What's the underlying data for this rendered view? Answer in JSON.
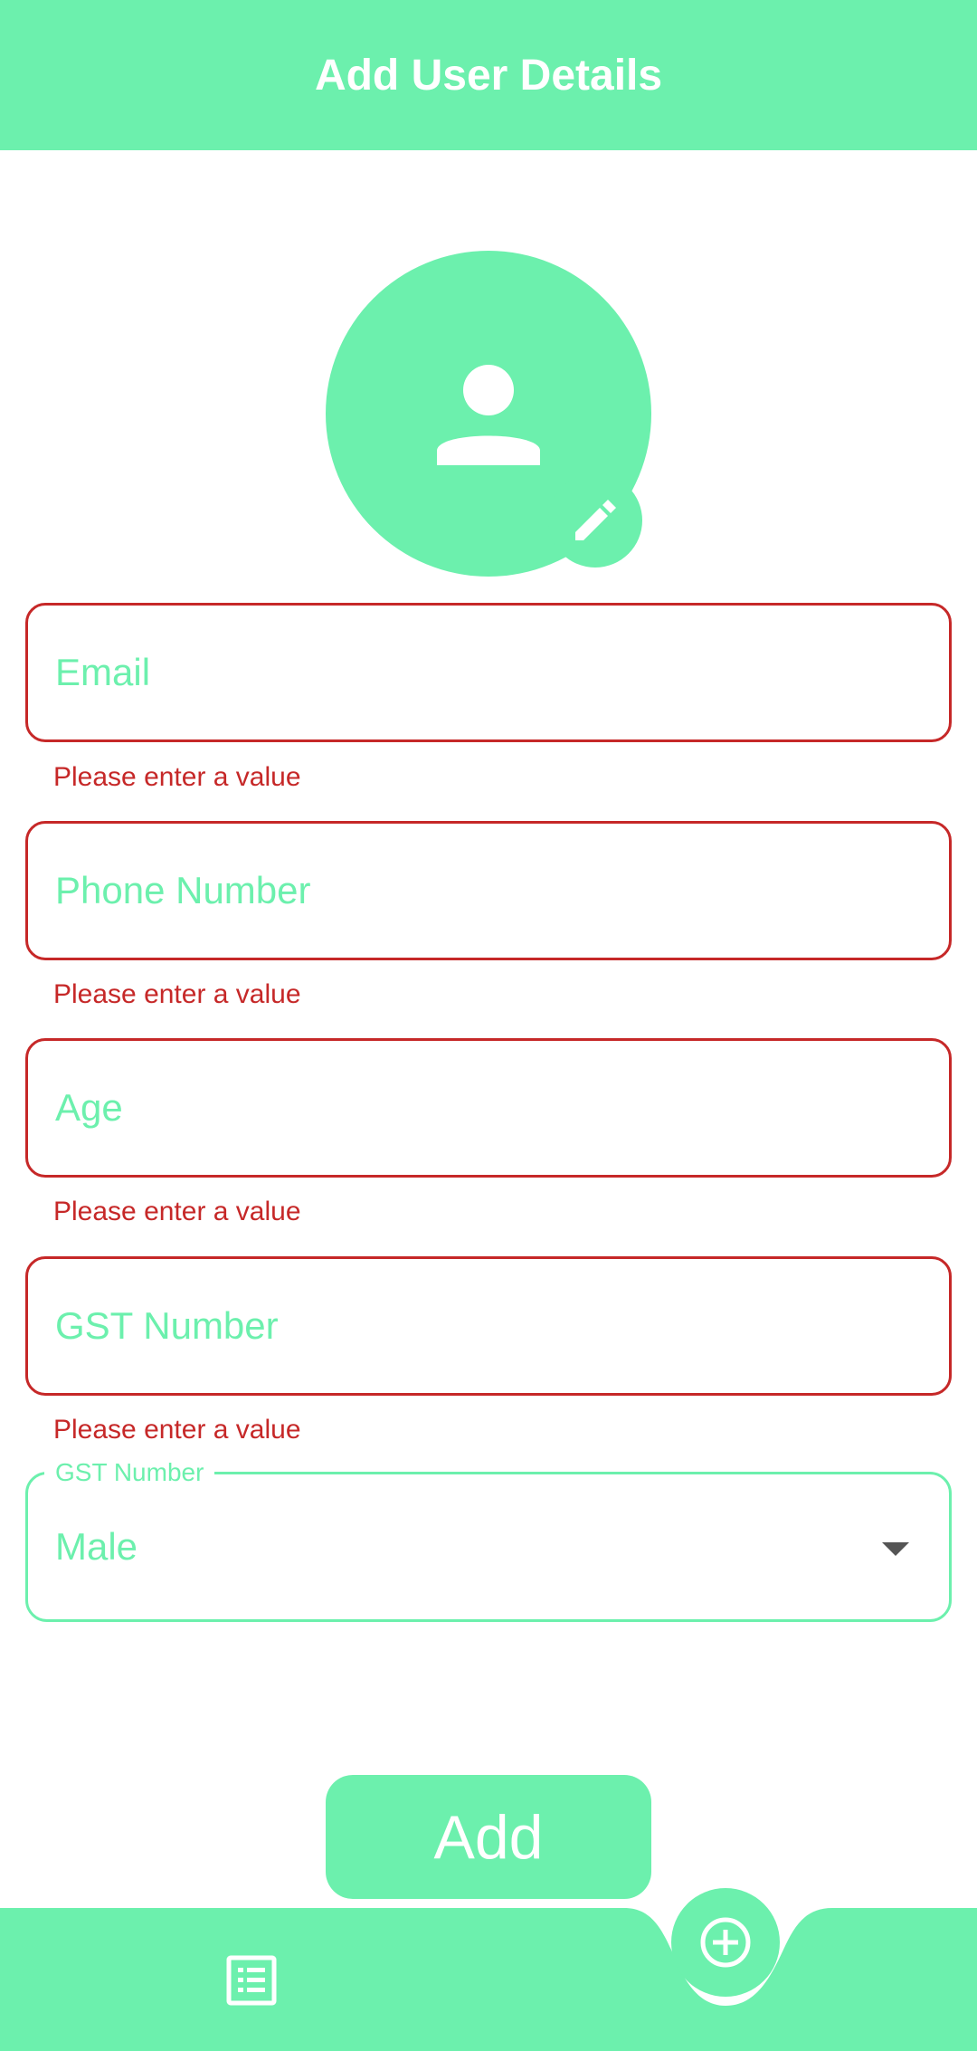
{
  "app_bar": {
    "title": "Add User Details"
  },
  "avatar": {
    "icon": "person-icon",
    "edit_icon": "pencil-icon"
  },
  "form": {
    "fields": [
      {
        "placeholder": "Email",
        "value": "",
        "error": "Please enter a value"
      },
      {
        "placeholder": "Phone Number",
        "value": "",
        "error": "Please enter a value"
      },
      {
        "placeholder": "Age",
        "value": "",
        "error": "Please enter a value"
      },
      {
        "placeholder": "GST Number",
        "value": "",
        "error": "Please enter a value"
      }
    ],
    "gender_dropdown": {
      "label": "GST Number",
      "selected": "Male"
    },
    "submit_label": "Add"
  },
  "bottom_nav": {
    "left_icon": "list-icon",
    "fab_icon": "add-circle-icon"
  },
  "colors": {
    "accent": "#6cf0ad",
    "error": "#c62828",
    "white": "#ffffff",
    "arrow": "#555555"
  }
}
